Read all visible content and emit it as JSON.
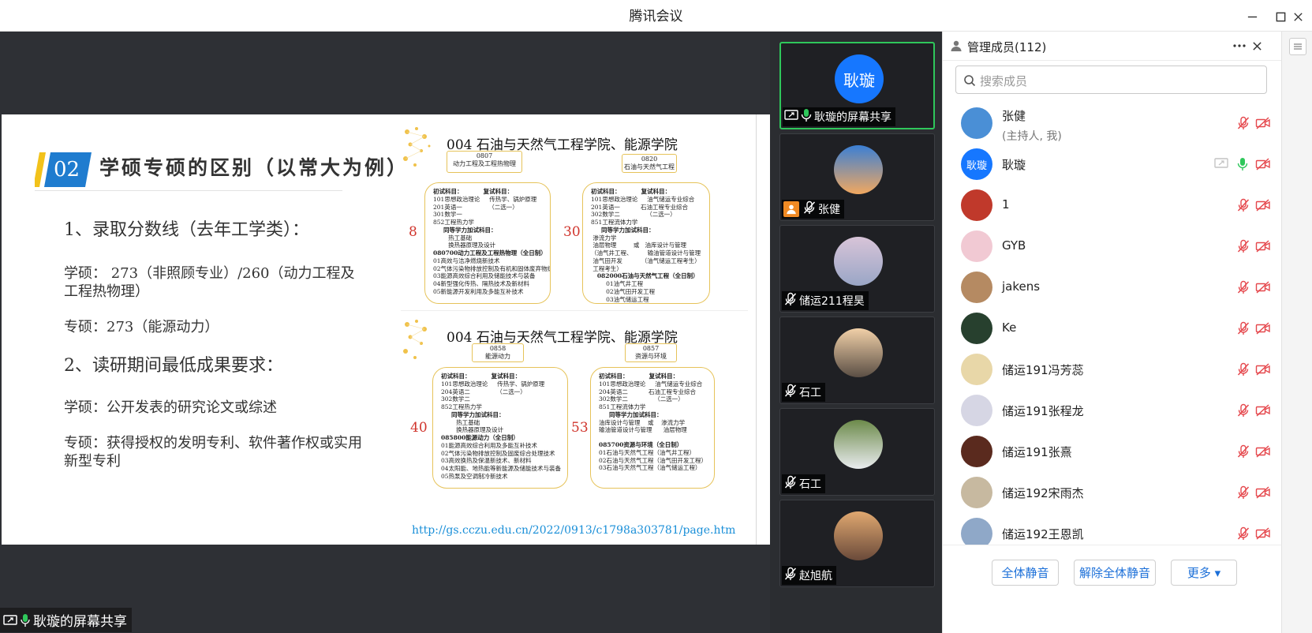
{
  "window": {
    "title": "腾讯会议"
  },
  "slide": {
    "badge_number": "02",
    "heading": "学硕专硕的区别（以常大为例）",
    "point1_title": "1、录取分数线（去年工学类）：",
    "point1_academic": "学硕：  273（非照顾专业）/260（动力工程及工程热物理）",
    "point1_professional": "专硕：273（能源动力）",
    "point2_title": "2、读研期间最低成果要求：",
    "point2_academic": "学硕：公开发表的研究论文或综述",
    "point2_professional": "专硕：获得授权的发明专利、软件著作权或实用新型专利",
    "panels": [
      {
        "title": "004  石油与天然气工程学院、能源学院",
        "left": {
          "code": "0807\n动力工程及工程热物理",
          "score": "8",
          "lines": [
            "初试科目：          复试科目：",
            "101思想政治理论     传热学、锅炉原理",
            "201英语一              （二选一）",
            "301数学一",
            "852工程热力学",
            "     同等学力加试科目：",
            "        热工基础",
            "        换热器原理及设计",
            "080700动力工程及工程热物理（全日制）",
            "01高效与洁净燃烧新技术",
            "02气体污染物排放控制及有机和固体废弃物综合处理技术",
            "03能源高效综合利用及储能技术与装备",
            "04新型强化传热、隔热技术及新材料",
            "05新能源开发利用及多能互补技术"
          ]
        },
        "right": {
          "code": "0820\n石油与天然气工程",
          "score": "30",
          "lines": [
            "初试科目：          复试科目：",
            "101思想政治理论     油气储运专业综合",
            "201英语一           石油工程专业综合",
            "302数学二              （二选一）",
            "851工程流体力学",
            "     同等学力加试科目：",
            " 渗流力学",
            " 油层物理         或   油库设计与管理",
            "（油气井工程、        输油管道设计与管理",
            " 油气田开发          （油气储运工程考生）",
            " 工程考生）",
            "   082000石油与天然气工程（全日制）",
            "        01油气井工程",
            "        02油气田开发工程",
            "        03油气储运工程"
          ]
        }
      },
      {
        "title": "004  石油与天然气工程学院、能源学院",
        "left": {
          "code": "0858\n能源动力",
          "score": "40",
          "lines": [
            "初试科目：          复试科目：",
            "101思想政治理论     传热学、锅炉原理",
            "204英语二              （二选一）",
            "302数学二",
            "852工程热力学",
            "     同等学力加试科目：",
            "        热工基础",
            "        换热器原理及设计",
            "085800能源动力（全日制）",
            "01能源高效综合利用及多能互补技术",
            "02气体污染物排放控制及固废综合处理技术",
            "03高效换热及保温新技术、新材料",
            "04太阳能、地热能等新能源及储能技术与装备",
            "05热泵及空调制冷新技术"
          ]
        },
        "right": {
          "code": "0857\n资源与环境",
          "score": "53",
          "lines": [
            "初试科目：          复试科目：",
            "101思想政治理论     油气储运专业综合",
            "204英语二           石油工程专业综合",
            "302数学二              （二选一）",
            "851工程流体力学",
            "     同等学力加试科目：",
            "油库设计与管理    或    渗流力学",
            "输油管道设计与管理      油层物理",
            "",
            "085700资源与环境（全日制）",
            "01石油与天然气工程（油气井工程）",
            "02石油与天然气工程（油气田开发工程）",
            "03石油与天然气工程（油气储运工程）"
          ]
        }
      }
    ],
    "url": "http://gs.cczu.edu.cn/2022/0913/c1798a303781/page.htm"
  },
  "share_label": "耿璇的屏幕共享",
  "video_tiles": [
    {
      "name": "耿璇的屏幕共享",
      "avatar_text": "耿璇",
      "active": true,
      "mic": "on",
      "screen": true
    },
    {
      "name": "张健",
      "avatar_text": "",
      "active": false,
      "mic": "muted",
      "host": true
    },
    {
      "name": "储运211程昊",
      "avatar_text": "",
      "active": false,
      "mic": "muted"
    },
    {
      "name": "石工",
      "avatar_text": "",
      "active": false,
      "mic": "muted"
    },
    {
      "name": "石工",
      "avatar_text": "",
      "active": false,
      "mic": "muted"
    },
    {
      "name": "赵旭航",
      "avatar_text": "",
      "active": false,
      "mic": "muted"
    }
  ],
  "members": {
    "title": "管理成员(112)",
    "search_placeholder": "搜索成员",
    "list": [
      {
        "name": "张健",
        "sub": "(主持人, 我)",
        "avatar_color": "#4a8fd6",
        "avatar_text": "",
        "mic": "muted",
        "screen": false
      },
      {
        "name": "耿璇",
        "sub": "",
        "avatar_color": "#1677ff",
        "avatar_text": "耿璇",
        "mic": "on",
        "screen": true
      },
      {
        "name": "1",
        "sub": "",
        "avatar_color": "#c0392b",
        "avatar_text": "",
        "mic": "muted",
        "screen": false
      },
      {
        "name": "GYB",
        "sub": "",
        "avatar_color": "#f1c9d3",
        "avatar_text": "",
        "mic": "muted",
        "screen": false
      },
      {
        "name": "jakens",
        "sub": "",
        "avatar_color": "#b58a62",
        "avatar_text": "",
        "mic": "muted",
        "screen": false
      },
      {
        "name": "Ke",
        "sub": "",
        "avatar_color": "#27402e",
        "avatar_text": "",
        "mic": "muted",
        "screen": false
      },
      {
        "name": "储运191冯芳蕊",
        "sub": "",
        "avatar_color": "#e8d7a8",
        "avatar_text": "",
        "mic": "muted",
        "screen": false
      },
      {
        "name": "储运191张程龙",
        "sub": "",
        "avatar_color": "#d6d6e4",
        "avatar_text": "",
        "mic": "muted",
        "screen": false
      },
      {
        "name": "储运191张熹",
        "sub": "",
        "avatar_color": "#5a2a1e",
        "avatar_text": "",
        "mic": "muted",
        "screen": false
      },
      {
        "name": "储运192宋雨杰",
        "sub": "",
        "avatar_color": "#c7b9a0",
        "avatar_text": "",
        "mic": "muted",
        "screen": false
      },
      {
        "name": "储运192王恩凯",
        "sub": "",
        "avatar_color": "#8fa8c8",
        "avatar_text": "",
        "mic": "muted",
        "screen": false
      }
    ]
  },
  "footer": {
    "mute_all": "全体静音",
    "unmute_all": "解除全体静音",
    "more": "更多 ▾"
  },
  "colors": {
    "accent": "#1677ff",
    "active_green": "#2fc75b",
    "muted_red": "#e5484d"
  }
}
